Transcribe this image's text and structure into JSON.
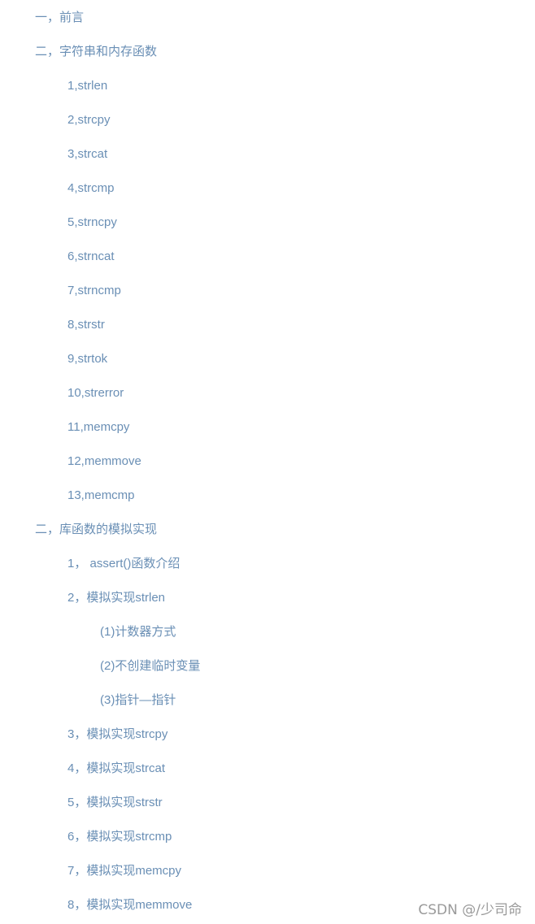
{
  "toc": {
    "items": [
      {
        "label": "一，前言"
      },
      {
        "label": "二，字符串和内存函数"
      },
      {
        "label": "1,strlen"
      },
      {
        "label": "2,strcpy"
      },
      {
        "label": "3,strcat"
      },
      {
        "label": "4,strcmp"
      },
      {
        "label": "5,strncpy"
      },
      {
        "label": "6,strncat"
      },
      {
        "label": "7,strncmp"
      },
      {
        "label": "8,strstr"
      },
      {
        "label": "9,strtok"
      },
      {
        "label": "10,strerror"
      },
      {
        "label": "11,memcpy"
      },
      {
        "label": "12,memmove"
      },
      {
        "label": "13,memcmp"
      },
      {
        "label": "二，库函数的模拟实现"
      },
      {
        "label": "1， assert()函数介绍"
      },
      {
        "label": "2，模拟实现strlen"
      },
      {
        "label": "(1)计数器方式"
      },
      {
        "label": "(2)不创建临时变量"
      },
      {
        "label": "(3)指针—指针"
      },
      {
        "label": "3，模拟实现strcpy"
      },
      {
        "label": "4，模拟实现strcat"
      },
      {
        "label": "5，模拟实现strstr"
      },
      {
        "label": "6，模拟实现strcmp"
      },
      {
        "label": "7，模拟实现memcpy"
      },
      {
        "label": "8，模拟实现memmove"
      }
    ]
  },
  "watermark": {
    "text": "CSDN @/少司命"
  },
  "colors": {
    "link": "#6a8fb5",
    "watermark": "#9a9a9a",
    "background": "#ffffff"
  }
}
